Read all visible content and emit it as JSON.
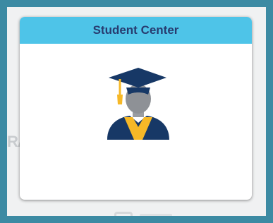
{
  "tile": {
    "title": "Student Center",
    "icon": "graduate-icon"
  },
  "colors": {
    "outer_border": "#3c8aa3",
    "header_bg": "#4ec4e8",
    "title_text": "#283c70",
    "navy": "#173866",
    "gold": "#f6b827",
    "head_gray": "#8e9196"
  }
}
